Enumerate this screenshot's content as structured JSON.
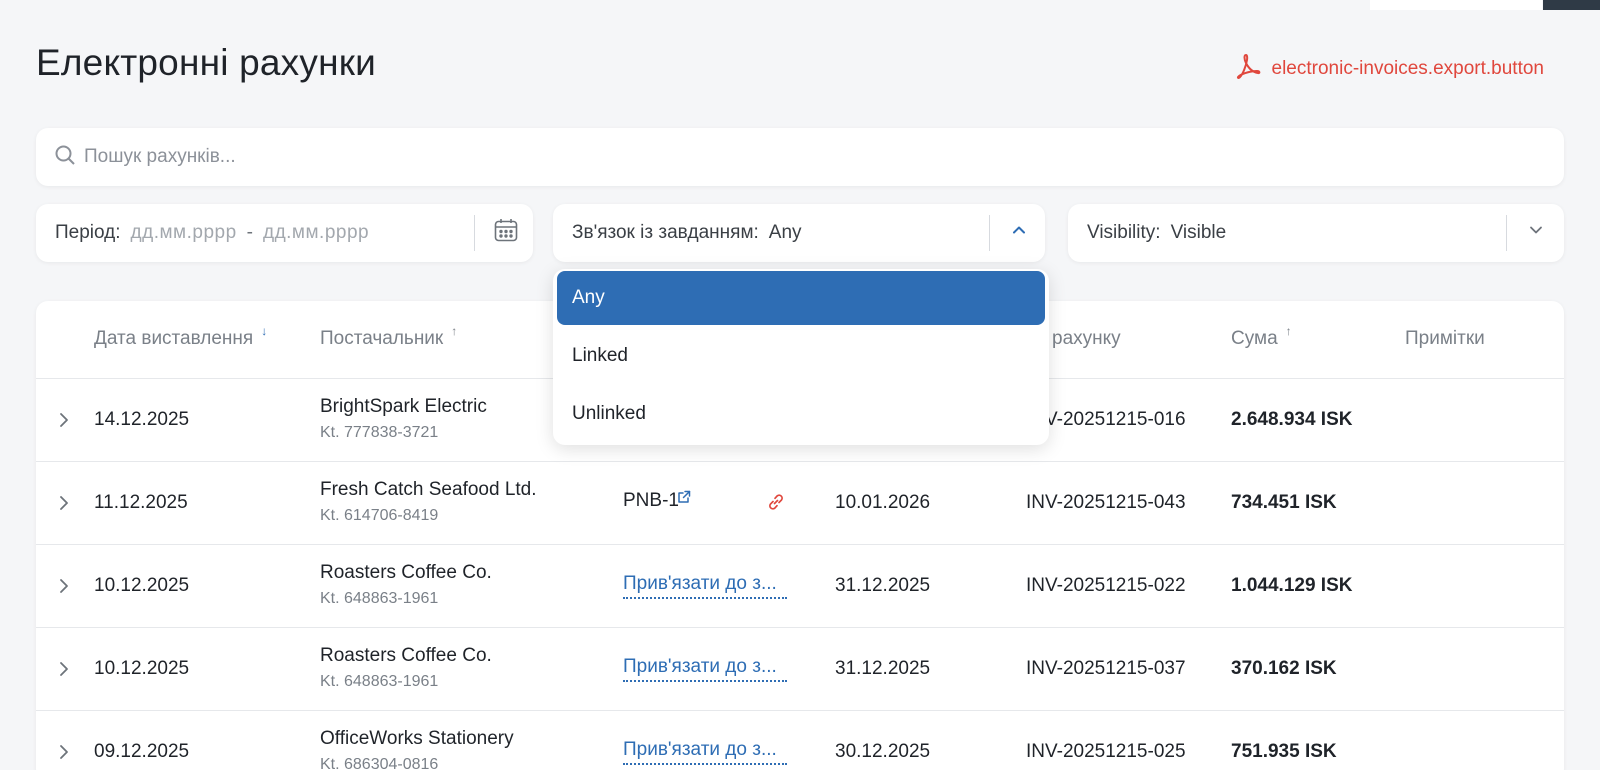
{
  "page": {
    "title": "Електронні рахунки",
    "export_label": "electronic-invoices.export.button"
  },
  "search": {
    "placeholder": "Пошук рахунків..."
  },
  "filters": {
    "period": {
      "label": "Період:",
      "from_placeholder": "дд.мм.рррр",
      "separator": "-",
      "to_placeholder": "дд.мм.рррр"
    },
    "task_link": {
      "label": "Зв'язок із завданням:",
      "value": "Any",
      "options": [
        "Any",
        "Linked",
        "Unlinked"
      ],
      "selected": "Any"
    },
    "visibility": {
      "label": "Visibility:",
      "value": "Visible"
    }
  },
  "table": {
    "columns": {
      "issue_date": "Дата виставлення",
      "supplier": "Постачальник",
      "invoice_no": "рахунку",
      "amount": "Сума",
      "notes": "Примітки"
    },
    "rows": [
      {
        "issue_date": "14.12.2025",
        "supplier": "BrightSpark Electric",
        "kt": "Kt. 777838-3721",
        "task": "",
        "due_date": "",
        "invoice_no": "INV-20251215-016",
        "amount": "2.648.934 ISK"
      },
      {
        "issue_date": "11.12.2025",
        "supplier": "Fresh Catch Seafood Ltd.",
        "kt": "Kt. 614706-8419",
        "task": "PNB-1",
        "due_date": "10.01.2026",
        "invoice_no": "INV-20251215-043",
        "amount": "734.451 ISK"
      },
      {
        "issue_date": "10.12.2025",
        "supplier": "Roasters Coffee Co.",
        "kt": "Kt. 648863-1961",
        "task": "Прив'язати до з...",
        "due_date": "31.12.2025",
        "invoice_no": "INV-20251215-022",
        "amount": "1.044.129 ISK"
      },
      {
        "issue_date": "10.12.2025",
        "supplier": "Roasters Coffee Co.",
        "kt": "Kt. 648863-1961",
        "task": "Прив'язати до з...",
        "due_date": "31.12.2025",
        "invoice_no": "INV-20251215-037",
        "amount": "370.162 ISK"
      },
      {
        "issue_date": "09.12.2025",
        "supplier": "OfficeWorks Stationery",
        "kt": "Kt. 686304-0816",
        "task": "Прив'язати до з...",
        "due_date": "30.12.2025",
        "invoice_no": "INV-20251215-025",
        "amount": "751.935 ISK"
      }
    ]
  },
  "colors": {
    "accent": "#2e6db4",
    "export": "#e0473d",
    "background": "#f5f6f8"
  }
}
